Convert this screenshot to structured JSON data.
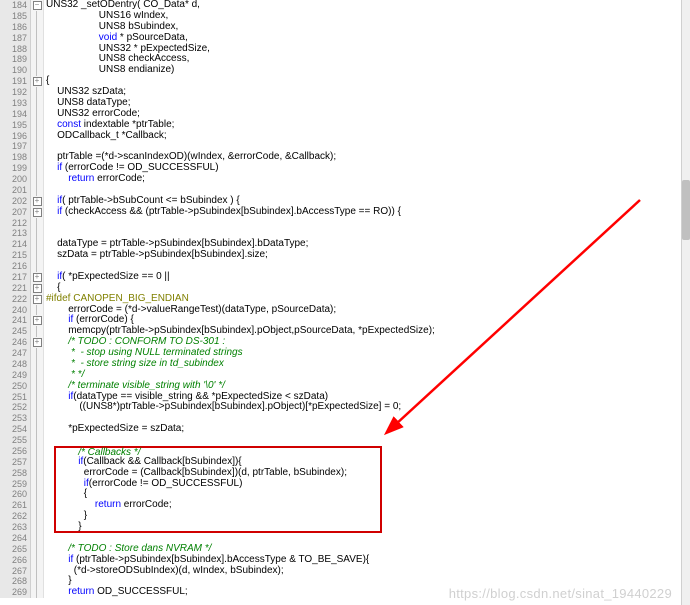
{
  "watermark": "https://blog.csdn.net/sinat_19440229",
  "colors": {
    "highlight_box": "#d00000",
    "arrow": "#ff0000"
  },
  "visible_range": [
    184,
    269
  ],
  "folded_lines": [
    191,
    202,
    207,
    217,
    221,
    222,
    241,
    246
  ],
  "highlight_box_lines": [
    256,
    263
  ],
  "lines": [
    {
      "n": 184,
      "fold": "minus",
      "text": "UNS32 _setODentry( CO_Data* d,",
      "span": [
        {
          "t": "UNS32 _setODentry( CO_Data* d,"
        }
      ]
    },
    {
      "n": 185,
      "fold": "line",
      "text": "                   UNS16 wIndex,",
      "span": [
        {
          "t": "                   UNS16 wIndex,"
        }
      ]
    },
    {
      "n": 186,
      "fold": "line",
      "text": "                   UNS8 bSubindex,",
      "span": [
        {
          "t": "                   UNS8 bSubindex,"
        }
      ]
    },
    {
      "n": 187,
      "fold": "line",
      "text": "                   void * pSourceData,",
      "span": [
        {
          "t": "                   "
        },
        {
          "kw": "void"
        },
        {
          "t": " * pSourceData,"
        }
      ]
    },
    {
      "n": 188,
      "fold": "line",
      "text": "                   UNS32 * pExpectedSize,",
      "span": [
        {
          "t": "                   UNS32 * pExpectedSize,"
        }
      ]
    },
    {
      "n": 189,
      "fold": "line",
      "text": "                   UNS8 checkAccess,",
      "span": [
        {
          "t": "                   UNS8 checkAccess,"
        }
      ]
    },
    {
      "n": 190,
      "fold": "line",
      "text": "                   UNS8 endianize)",
      "span": [
        {
          "t": "                   UNS8 endianize)"
        }
      ]
    },
    {
      "n": 191,
      "fold": "plus",
      "text": "{",
      "span": [
        {
          "t": "{"
        }
      ]
    },
    {
      "n": 192,
      "fold": "line",
      "text": "    UNS32 szData;",
      "span": [
        {
          "t": "    UNS32 szData;"
        }
      ]
    },
    {
      "n": 193,
      "fold": "line",
      "text": "    UNS8 dataType;",
      "span": [
        {
          "t": "    UNS8 dataType;"
        }
      ]
    },
    {
      "n": 194,
      "fold": "line",
      "text": "    UNS32 errorCode;",
      "span": [
        {
          "t": "    UNS32 errorCode;"
        }
      ]
    },
    {
      "n": 195,
      "fold": "line",
      "text": "    const indextable *ptrTable;",
      "span": [
        {
          "kw": "    const"
        },
        {
          "t": " indextable *ptrTable;"
        }
      ]
    },
    {
      "n": 196,
      "fold": "line",
      "text": "    ODCallback_t *Callback;",
      "span": [
        {
          "t": "    ODCallback_t *Callback;"
        }
      ]
    },
    {
      "n": 197,
      "fold": "line",
      "text": "",
      "span": []
    },
    {
      "n": 198,
      "fold": "line",
      "text": "    ptrTable =(*d->scanIndexOD)(wIndex, &errorCode, &Callback);",
      "span": [
        {
          "t": "    ptrTable =(*d->scanIndexOD)(wIndex, &errorCode, &Callback);"
        }
      ]
    },
    {
      "n": 199,
      "fold": "line",
      "text": "    if (errorCode != OD_SUCCESSFUL)",
      "span": [
        {
          "t": "    "
        },
        {
          "kw": "if"
        },
        {
          "t": " (errorCode != OD_SUCCESSFUL)"
        }
      ]
    },
    {
      "n": 200,
      "fold": "line",
      "text": "        return errorCode;",
      "span": [
        {
          "t": "        "
        },
        {
          "kw": "return"
        },
        {
          "t": " errorCode;"
        }
      ]
    },
    {
      "n": 201,
      "fold": "line",
      "text": "",
      "span": []
    },
    {
      "n": 202,
      "fold": "plus",
      "text": "    if( ptrTable->bSubCount <= bSubindex ) {",
      "span": [
        {
          "t": "    "
        },
        {
          "kw": "if"
        },
        {
          "t": "( ptrTable->bSubCount <= bSubindex ) {"
        }
      ]
    },
    {
      "n": 207,
      "fold": "plus",
      "text": "    if (checkAccess && (ptrTable->pSubindex[bSubindex].bAccessType == RO)) {",
      "span": [
        {
          "t": "    "
        },
        {
          "kw": "if"
        },
        {
          "t": " (checkAccess && (ptrTable->pSubindex[bSubindex].bAccessType == RO)) {"
        }
      ]
    },
    {
      "n": 212,
      "fold": "line",
      "text": "",
      "span": []
    },
    {
      "n": 213,
      "fold": "line",
      "text": "",
      "span": []
    },
    {
      "n": 214,
      "fold": "line",
      "text": "    dataType = ptrTable->pSubindex[bSubindex].bDataType;",
      "span": [
        {
          "t": "    dataType = ptrTable->pSubindex[bSubindex].bDataType;"
        }
      ]
    },
    {
      "n": 215,
      "fold": "line",
      "text": "    szData = ptrTable->pSubindex[bSubindex].size;",
      "span": [
        {
          "t": "    szData = ptrTable->pSubindex[bSubindex].size;"
        }
      ]
    },
    {
      "n": 216,
      "fold": "line",
      "text": "",
      "span": []
    },
    {
      "n": 217,
      "fold": "plus",
      "text": "    if( *pExpectedSize == 0 ||",
      "span": [
        {
          "t": "    "
        },
        {
          "kw": "if"
        },
        {
          "t": "( *pExpectedSize == "
        },
        {
          "num": "0"
        },
        {
          "t": " ||"
        }
      ]
    },
    {
      "n": 221,
      "fold": "plus",
      "text": "    {",
      "span": [
        {
          "t": "    {"
        }
      ]
    },
    {
      "n": 222,
      "fold": "plus",
      "text": "#ifdef CANOPEN_BIG_ENDIAN",
      "span": [
        {
          "pp": "#ifdef CANOPEN_BIG_ENDIAN"
        }
      ]
    },
    {
      "n": 240,
      "fold": "line",
      "text": "        errorCode = (*d->valueRangeTest)(dataType, pSourceData);",
      "span": [
        {
          "t": "        errorCode = (*d->valueRangeTest)(dataType, pSourceData);"
        }
      ]
    },
    {
      "n": 241,
      "fold": "plus",
      "text": "        if (errorCode) {",
      "span": [
        {
          "t": "        "
        },
        {
          "kw": "if"
        },
        {
          "t": " (errorCode) {"
        }
      ]
    },
    {
      "n": 245,
      "fold": "line",
      "text": "        memcpy(ptrTable->pSubindex[bSubindex].pObject,pSourceData, *pExpectedSize);",
      "span": [
        {
          "t": "        memcpy(ptrTable->pSubindex[bSubindex].pObject,pSourceData, *pExpectedSize);"
        }
      ]
    },
    {
      "n": 246,
      "fold": "plus",
      "text": "        /* TODO : CONFORM TO DS-301 :",
      "span": [
        {
          "t": "        "
        },
        {
          "cm": "/* TODO : CONFORM TO DS-301 :"
        }
      ]
    },
    {
      "n": 247,
      "fold": "line",
      "text": "         *  - stop using NULL terminated strings",
      "span": [
        {
          "cm": "         *  - stop using NULL terminated strings"
        }
      ]
    },
    {
      "n": 248,
      "fold": "line",
      "text": "         *  - store string size in td_subindex",
      "span": [
        {
          "cm": "         *  - store string size in td_subindex"
        }
      ]
    },
    {
      "n": 249,
      "fold": "line",
      "text": "         * */",
      "span": [
        {
          "cm": "         * */"
        }
      ]
    },
    {
      "n": 250,
      "fold": "line",
      "text": "        /* terminate visible_string with '\\0' */",
      "span": [
        {
          "t": "        "
        },
        {
          "cm": "/* terminate visible_string with '\\0' */"
        }
      ]
    },
    {
      "n": 251,
      "fold": "line",
      "text": "        if(dataType == visible_string && *pExpectedSize < szData)",
      "span": [
        {
          "t": "        "
        },
        {
          "kw": "if"
        },
        {
          "t": "(dataType == visible_string && *pExpectedSize < szData)"
        }
      ]
    },
    {
      "n": 252,
      "fold": "line",
      "text": "            ((UNS8*)ptrTable->pSubindex[bSubindex].pObject)[*pExpectedSize] = 0;",
      "span": [
        {
          "t": "            ((UNS8*)ptrTable->pSubindex[bSubindex].pObject)[*pExpectedSize] = "
        },
        {
          "num": "0"
        },
        {
          "t": ";"
        }
      ]
    },
    {
      "n": 253,
      "fold": "line",
      "text": "",
      "span": []
    },
    {
      "n": 254,
      "fold": "line",
      "text": "        *pExpectedSize = szData;",
      "span": [
        {
          "t": "        *pExpectedSize = szData;"
        }
      ]
    },
    {
      "n": 255,
      "fold": "line",
      "text": "",
      "span": []
    },
    {
      "n": 256,
      "fold": "line",
      "text": "        /* Callbacks */",
      "span": [
        {
          "t": "        "
        },
        {
          "cm": "/* Callbacks */"
        }
      ]
    },
    {
      "n": 257,
      "fold": "line",
      "text": "        if(Callback && Callback[bSubindex]){",
      "span": [
        {
          "t": "        "
        },
        {
          "kw": "if"
        },
        {
          "t": "(Callback && Callback[bSubindex]){"
        }
      ]
    },
    {
      "n": 258,
      "fold": "line",
      "text": "          errorCode = (Callback[bSubindex])(d, ptrTable, bSubindex);",
      "span": [
        {
          "t": "          errorCode = (Callback[bSubindex])(d, ptrTable, bSubindex);"
        }
      ]
    },
    {
      "n": 259,
      "fold": "line",
      "text": "          if(errorCode != OD_SUCCESSFUL)",
      "span": [
        {
          "t": "          "
        },
        {
          "kw": "if"
        },
        {
          "t": "(errorCode != OD_SUCCESSFUL)"
        }
      ]
    },
    {
      "n": 260,
      "fold": "line",
      "text": "          {",
      "span": [
        {
          "t": "          {"
        }
      ]
    },
    {
      "n": 261,
      "fold": "line",
      "text": "              return errorCode;",
      "span": [
        {
          "t": "              "
        },
        {
          "kw": "return"
        },
        {
          "t": " errorCode;"
        }
      ]
    },
    {
      "n": 262,
      "fold": "line",
      "text": "          }",
      "span": [
        {
          "t": "          }"
        }
      ]
    },
    {
      "n": 263,
      "fold": "line",
      "text": "        }",
      "span": [
        {
          "t": "        }"
        }
      ]
    },
    {
      "n": 264,
      "fold": "line",
      "text": "",
      "span": []
    },
    {
      "n": 265,
      "fold": "line",
      "text": "        /* TODO : Store dans NVRAM */",
      "span": [
        {
          "t": "        "
        },
        {
          "cm": "/* TODO : Store dans NVRAM */"
        }
      ]
    },
    {
      "n": 266,
      "fold": "line",
      "text": "        if (ptrTable->pSubindex[bSubindex].bAccessType & TO_BE_SAVE){",
      "span": [
        {
          "t": "        "
        },
        {
          "kw": "if"
        },
        {
          "t": " (ptrTable->pSubindex[bSubindex].bAccessType & TO_BE_SAVE){"
        }
      ]
    },
    {
      "n": 267,
      "fold": "line",
      "text": "          (*d->storeODSubIndex)(d, wIndex, bSubindex);",
      "span": [
        {
          "t": "          (*d->storeODSubIndex)(d, wIndex, bSubindex);"
        }
      ]
    },
    {
      "n": 268,
      "fold": "line",
      "text": "        }",
      "span": [
        {
          "t": "        }"
        }
      ]
    },
    {
      "n": 269,
      "fold": "line",
      "text": "        return OD_SUCCESSFUL;",
      "span": [
        {
          "t": "        "
        },
        {
          "kw": "return"
        },
        {
          "t": " OD_SUCCESSFUL;"
        }
      ]
    }
  ]
}
